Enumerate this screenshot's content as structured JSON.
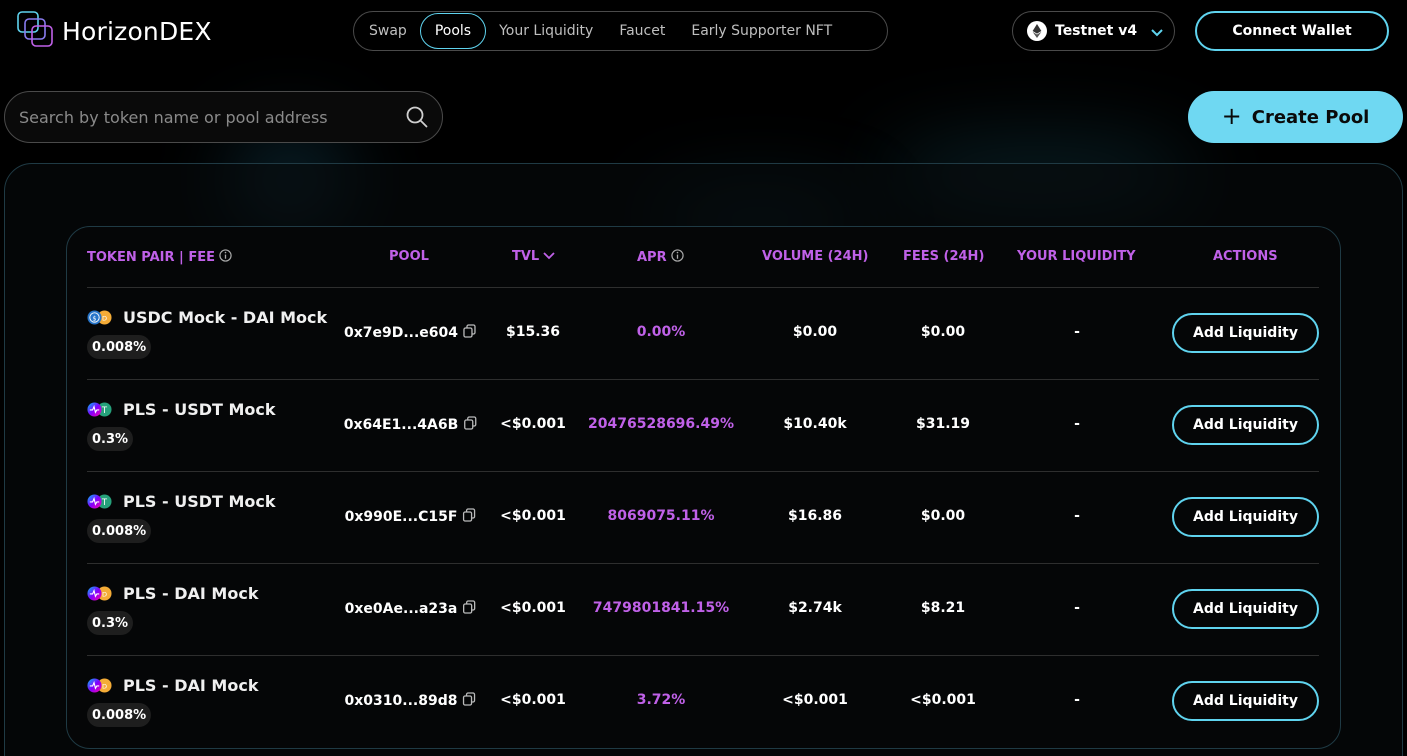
{
  "app": {
    "name": "HorizonDEX"
  },
  "nav": {
    "items": [
      {
        "label": "Swap",
        "active": false
      },
      {
        "label": "Pools",
        "active": true
      },
      {
        "label": "Your Liquidity",
        "active": false
      },
      {
        "label": "Faucet",
        "active": false
      },
      {
        "label": "Early Supporter NFT",
        "active": false
      }
    ]
  },
  "network": {
    "label": "Testnet v4",
    "icon": "ethereum-icon"
  },
  "wallet": {
    "connect_label": "Connect Wallet"
  },
  "search": {
    "placeholder": "Search by token name or pool address",
    "value": ""
  },
  "create_pool": {
    "label": "Create Pool"
  },
  "table": {
    "columns": {
      "pair": "TOKEN PAIR | FEE",
      "pool": "POOL",
      "tvl": "TVL",
      "apr": "APR",
      "volume": "VOLUME (24H)",
      "fees": "FEES (24H)",
      "your_liquidity": "YOUR LIQUIDITY",
      "actions": "ACTIONS"
    },
    "sort": {
      "column": "TVL",
      "direction": "desc"
    },
    "rows": [
      {
        "pair": "USDC Mock - DAI Mock",
        "fee": "0.008%",
        "pool": "0x7e9D...e604",
        "tvl": "$15.36",
        "apr": "0.00%",
        "volume": "$0.00",
        "fees": "$0.00",
        "your_liquidity": "-",
        "action": "Add Liquidity",
        "icons": [
          "usdc-icon",
          "dai-icon"
        ]
      },
      {
        "pair": "PLS - USDT Mock",
        "fee": "0.3%",
        "pool": "0x64E1...4A6B",
        "tvl": "<$0.001",
        "apr": "20476528696.49%",
        "volume": "$10.40k",
        "fees": "$31.19",
        "your_liquidity": "-",
        "action": "Add Liquidity",
        "icons": [
          "pls-icon",
          "usdt-icon"
        ]
      },
      {
        "pair": "PLS - USDT Mock",
        "fee": "0.008%",
        "pool": "0x990E...C15F",
        "tvl": "<$0.001",
        "apr": "8069075.11%",
        "volume": "$16.86",
        "fees": "$0.00",
        "your_liquidity": "-",
        "action": "Add Liquidity",
        "icons": [
          "pls-icon",
          "usdt-icon"
        ]
      },
      {
        "pair": "PLS - DAI Mock",
        "fee": "0.3%",
        "pool": "0xe0Ae...a23a",
        "tvl": "<$0.001",
        "apr": "7479801841.15%",
        "volume": "$2.74k",
        "fees": "$8.21",
        "your_liquidity": "-",
        "action": "Add Liquidity",
        "icons": [
          "pls-icon",
          "dai-icon"
        ]
      },
      {
        "pair": "PLS - DAI Mock",
        "fee": "0.008%",
        "pool": "0x0310...89d8",
        "tvl": "<$0.001",
        "apr": "3.72%",
        "volume": "<$0.001",
        "fees": "<$0.001",
        "your_liquidity": "-",
        "action": "Add Liquidity",
        "icons": [
          "pls-icon",
          "dai-icon"
        ]
      }
    ]
  },
  "colors": {
    "accent": "#5fd3ee",
    "header_text": "#c061e8",
    "primary_button": "#6fd8f2"
  }
}
